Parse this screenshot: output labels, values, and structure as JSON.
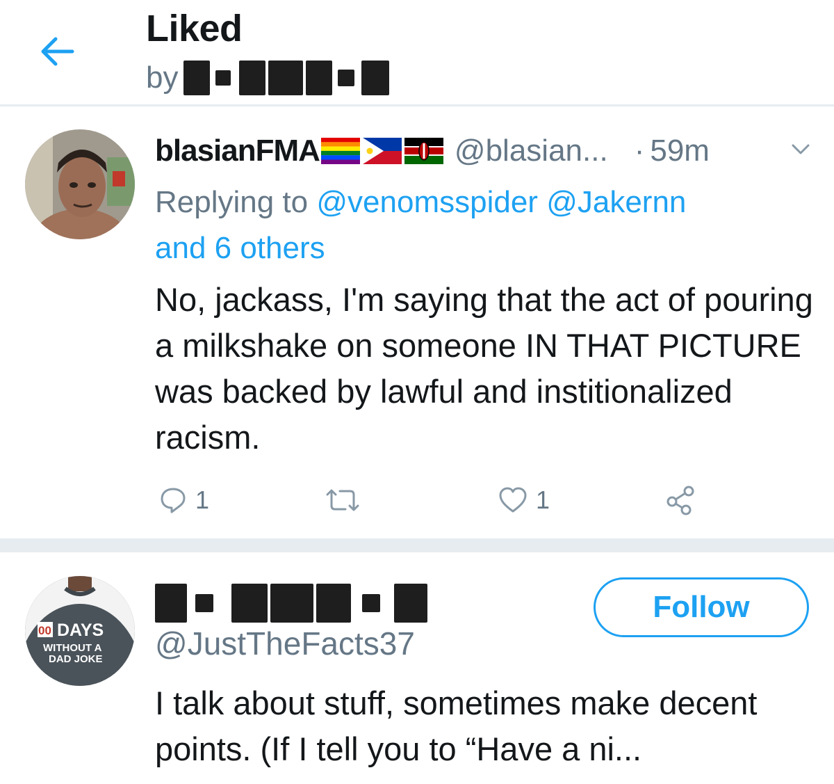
{
  "header": {
    "title": "Liked",
    "by_prefix": "by"
  },
  "tweet": {
    "display_name": "blasianFMA",
    "flags": [
      "rainbow-flag",
      "philippines-flag",
      "kenya-flag"
    ],
    "handle": "@blasian...",
    "dot": "·",
    "time": "59m",
    "replying_prefix": "Replying to",
    "replying_users": [
      "@venomsspider",
      "@Jakernn"
    ],
    "replying_others": "and 6 others",
    "text": "No, jackass, I'm saying that the act of pouring a milkshake on someone IN THAT PICTURE was backed by lawful and institionalized racism.",
    "reply_count": "1",
    "like_count": "1"
  },
  "user_card": {
    "handle": "@JustTheFacts37",
    "follow_label": "Follow",
    "bio": "I talk about stuff, sometimes make decent points. (If I tell you to “Have a ni...",
    "avatar_shirt": {
      "counter": "00",
      "line1": "DAYS",
      "line2": "WITHOUT A",
      "line3": "DAD JOKE"
    }
  },
  "colors": {
    "accent": "#1da1f2",
    "muted": "#657786",
    "text": "#14171a",
    "divider": "#e6ecf0"
  }
}
